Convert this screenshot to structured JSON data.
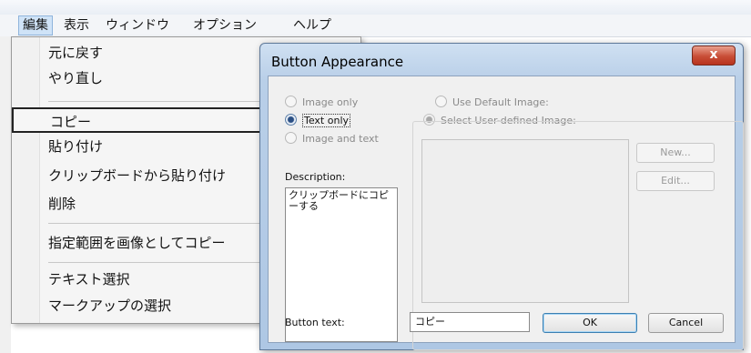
{
  "menubar": {
    "items": [
      "編集",
      "表示",
      "ウィンドウ",
      "オプション",
      "ヘルプ"
    ],
    "active": "編集"
  },
  "edit_menu": {
    "undo": "元に戻す",
    "redo": "やり直し",
    "copy": "コピー",
    "paste": "貼り付け",
    "paste_from_clipboard": "クリップボードから貼り付け",
    "delete": "削除",
    "copy_as_image": "指定範囲を画像としてコピー",
    "select_text": "テキスト選択",
    "select_markup": "マークアップの選択"
  },
  "dialog": {
    "title": "Button Appearance",
    "close_glyph": "x",
    "radio_image_only": "Image only",
    "radio_text_only": "Text only",
    "radio_image_and_text": "Image and text",
    "radio_use_default_image": "Use Default Image:",
    "radio_select_user_image": "Select User-defined Image:",
    "selected_radio": "Text only",
    "new_button": "New...",
    "edit_button": "Edit...",
    "description_label": "Description:",
    "description_value": "クリップボードにコピーする",
    "button_text_label": "Button text:",
    "button_text_value": "コピー",
    "ok_button": "OK",
    "cancel_button": "Cancel"
  },
  "colors": {
    "menu_highlight": "#cfe3f7",
    "dialog_frame": "#b9cfe8",
    "close_button": "#c84d36",
    "default_button_border": "#3c7fb1"
  },
  "icons": [
    "close-icon",
    "radio-icon"
  ]
}
